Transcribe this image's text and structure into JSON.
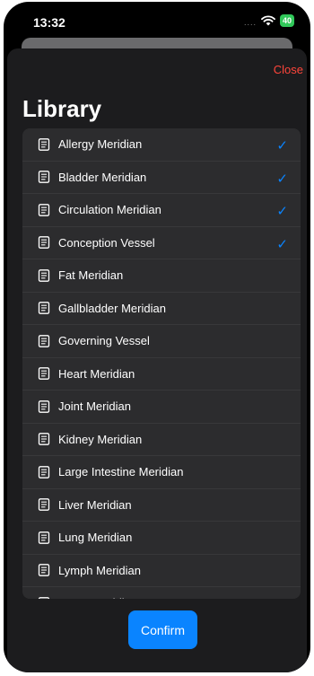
{
  "status_bar": {
    "time": "13:32",
    "battery": "40",
    "signal_dots": "....",
    "icons": [
      "wifi-icon",
      "battery-icon"
    ]
  },
  "sheet": {
    "close_label": "Close",
    "title": "Library",
    "confirm_label": "Confirm"
  },
  "colors": {
    "accent": "#0a84ff",
    "close": "#ff453a",
    "sheet_bg": "#1c1c1e",
    "list_bg": "#2c2c2e"
  },
  "items": [
    {
      "label": "Allergy Meridian",
      "checked": true
    },
    {
      "label": "Bladder Meridian",
      "checked": true
    },
    {
      "label": "Circulation Meridian",
      "checked": true
    },
    {
      "label": "Conception Vessel",
      "checked": true
    },
    {
      "label": "Fat Meridian",
      "checked": false
    },
    {
      "label": "Gallbladder Meridian",
      "checked": false
    },
    {
      "label": "Governing Vessel",
      "checked": false
    },
    {
      "label": "Heart Meridian",
      "checked": false
    },
    {
      "label": "Joint Meridian",
      "checked": false
    },
    {
      "label": "Kidney Meridian",
      "checked": false
    },
    {
      "label": "Large Intestine Meridian",
      "checked": false
    },
    {
      "label": "Liver Meridian",
      "checked": false
    },
    {
      "label": "Lung Meridian",
      "checked": false
    },
    {
      "label": "Lymph Meridian",
      "checked": false
    },
    {
      "label": "Nerve Meridian",
      "checked": false
    }
  ]
}
